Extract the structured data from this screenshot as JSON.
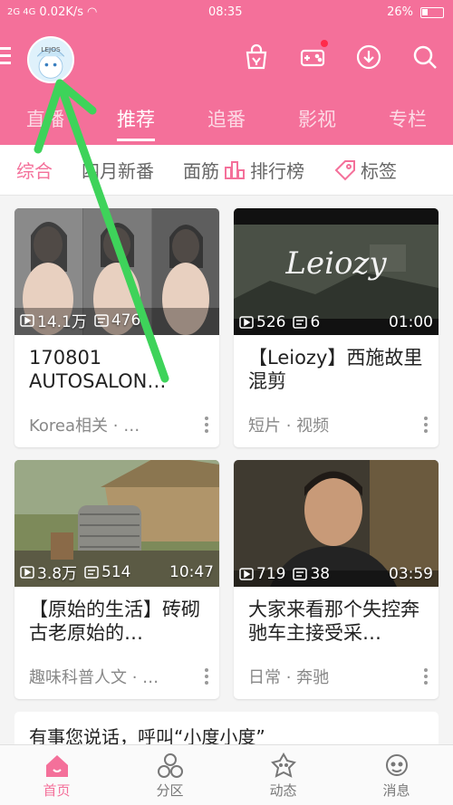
{
  "statusbar": {
    "signal": "2G 4G",
    "speed": "0.02K/s",
    "time": "08:35",
    "battery": "26%"
  },
  "topbar": {
    "avatar_text": "LEJOS"
  },
  "tabs": [
    {
      "label": "直播"
    },
    {
      "label": "推荐",
      "active": true
    },
    {
      "label": "追番"
    },
    {
      "label": "影视"
    },
    {
      "label": "专栏"
    }
  ],
  "filters": {
    "all": "综合",
    "april": "四月新番",
    "tendon": "面筋",
    "rank": "排行榜",
    "tags": "标签"
  },
  "cards": [
    {
      "views": "14.1万",
      "danmaku": "476",
      "duration": "",
      "title": "170801 AUTOSALON…",
      "category": "Korea相关 · …"
    },
    {
      "views": "526",
      "danmaku": "6",
      "duration": "01:00",
      "thumb_text": "Leiozy",
      "title": "【Leiozy】西施故里混剪",
      "category": "短片 · 视频"
    },
    {
      "views": "3.8万",
      "danmaku": "514",
      "duration": "10:47",
      "title": "【原始的生活】砖砌古老原始的…",
      "category": "趣味科普人文 · …"
    },
    {
      "views": "719",
      "danmaku": "38",
      "duration": "03:59",
      "title": "大家来看那个失控奔驰车主接受采…",
      "category": "日常 · 奔驰"
    }
  ],
  "partial_card": {
    "text": "有事您说话，呼叫“小度小度”"
  },
  "bottomnav": [
    {
      "label": "首页",
      "active": true
    },
    {
      "label": "分区"
    },
    {
      "label": "动态"
    },
    {
      "label": "消息"
    }
  ],
  "colors": {
    "primary": "#f4709a",
    "arrow": "#3ed35a"
  }
}
